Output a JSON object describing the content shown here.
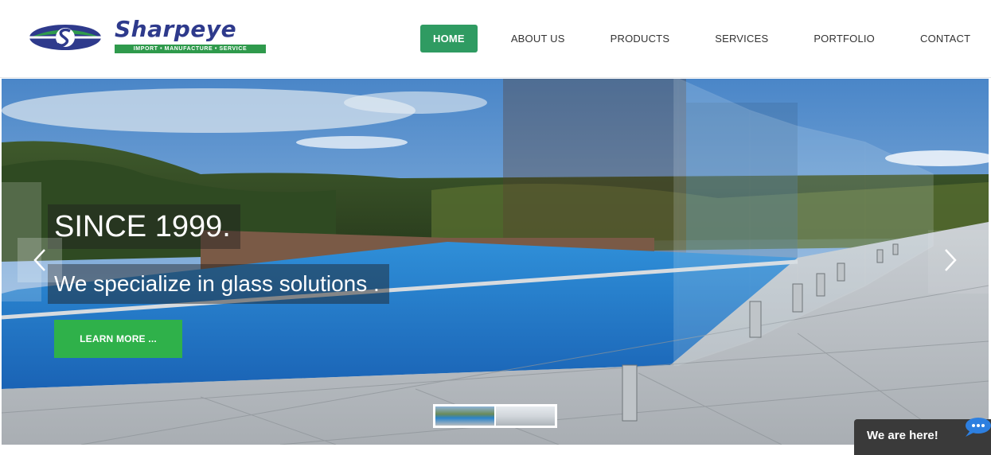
{
  "brand": {
    "name": "Sharpeye",
    "tagline": "IMPORT • MANUFACTURE • SERVICE",
    "colors": {
      "blue": "#2e3a8c",
      "green": "#2f9a4c"
    }
  },
  "nav": {
    "items": [
      {
        "label": "HOME",
        "active": true
      },
      {
        "label": "ABOUT US"
      },
      {
        "label": "PRODUCTS"
      },
      {
        "label": "SERVICES"
      },
      {
        "label": "PORTFOLIO"
      },
      {
        "label": "CONTACT"
      }
    ],
    "active_color": "#2f9b62"
  },
  "hero": {
    "title": "SINCE 1999.",
    "subtitle": "We specialize in glass solutions .",
    "cta_label": "LEARN MORE ...",
    "cta_color": "#2fb14a",
    "prev_icon": "chevron-left-icon",
    "next_icon": "chevron-right-icon",
    "slide_count": 2,
    "active_slide": 1
  },
  "chat": {
    "label": "We are here!",
    "icon": "chat-bubble-icon"
  }
}
